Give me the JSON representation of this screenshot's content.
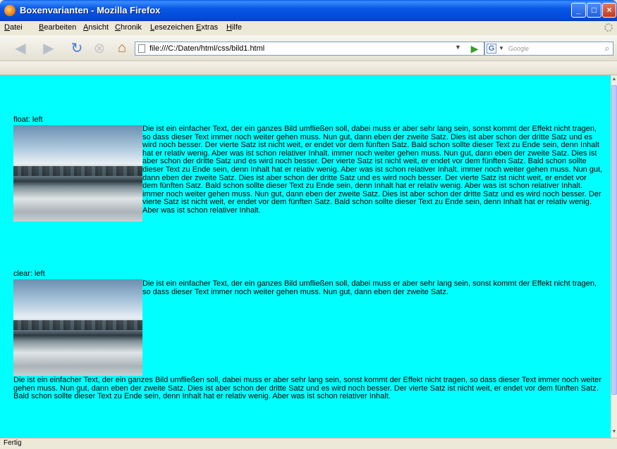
{
  "window": {
    "title": "Boxenvarianten - Mozilla Firefox"
  },
  "menu": [
    "Datei",
    "Bearbeiten",
    "Ansicht",
    "Chronik",
    "Lesezeichen",
    "Extras",
    "Hilfe"
  ],
  "nav": {
    "url": "file:///C:/Daten/html/css/bild1.html",
    "search_placeholder": "Google",
    "search_engine_letter": "G"
  },
  "page": {
    "section1_label": "float: left",
    "section1_text": "Die ist ein einfacher Text, der ein ganzes Bild umfließen soll, dabei muss er aber sehr lang sein, sonst kommt der Effekt nicht tragen, so dass dieser Text immer noch weiter gehen muss. Nun gut, dann eben der zweite Satz. Dies ist aber schon der dritte Satz und es wird noch besser. Der vierte Satz ist nicht weit, er endet vor dem fünften Satz. Bald schon sollte dieser Text zu Ende sein, denn Inhalt hat er relativ wenig. Aber was ist schon relativer Inhalt. immer noch weiter gehen muss. Nun gut, dann eben der zweite Satz. Dies ist aber schon der dritte Satz und es wird noch besser. Der vierte Satz ist nicht weit, er endet vor dem fünften Satz. Bald schon sollte dieser Text zu Ende sein, denn Inhalt hat er relativ wenig. Aber was ist schon relativer Inhalt. immer noch weiter gehen muss. Nun gut, dann eben der zweite Satz. Dies ist aber schon der dritte Satz und es wird noch besser. Der vierte Satz ist nicht weit, er endet vor dem fünften Satz. Bald schon sollte dieser Text zu Ende sein, denn Inhalt hat er relativ wenig. Aber was ist schon relativer Inhalt. immer noch weiter gehen muss. Nun gut, dann eben der zweite Satz. Dies ist aber schon der dritte Satz und es wird noch besser. Der vierte Satz ist nicht weit, er endet vor dem fünften Satz. Bald schon sollte dieser Text zu Ende sein, denn Inhalt hat er relativ wenig. Aber was ist schon relativer Inhalt.",
    "section2_label": "clear: left",
    "section2_top_text": "Die ist ein einfacher Text, der ein ganzes Bild umfließen soll, dabei muss er aber sehr lang sein, sonst kommt der Effekt nicht tragen, so dass dieser Text immer noch weiter gehen muss. Nun gut, dann eben der zweite Satz.",
    "section2_bottom_text": "Die ist ein einfacher Text, der ein ganzes Bild umfließen soll, dabei muss er aber sehr lang sein, sonst kommt der Effekt nicht tragen, so dass dieser Text immer noch weiter gehen muss. Nun gut, dann eben der zweite Satz. Dies ist aber schon der dritte Satz und es wird noch besser. Der vierte Satz ist nicht weit, er endet vor dem fünften Satz. Bald schon sollte dieser Text zu Ende sein, denn Inhalt hat er relativ wenig. Aber was ist schon relativer Inhalt."
  },
  "status": {
    "text": "Fertig"
  },
  "colors": {
    "page_background": "#00ffff",
    "titlebar": "#0a5ee8"
  },
  "icons": [
    "firefox-icon",
    "back-arrow-icon",
    "forward-arrow-icon",
    "reload-icon",
    "stop-icon",
    "home-icon",
    "page-icon",
    "go-arrow-icon",
    "search-engine-icon",
    "magnifier-icon"
  ]
}
